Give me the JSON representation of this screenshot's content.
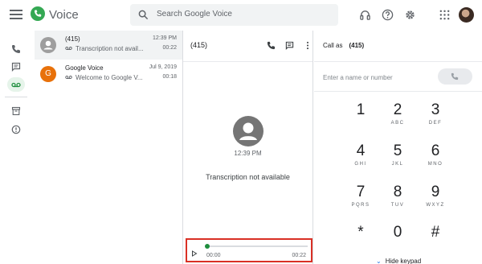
{
  "app": {
    "title": "Voice",
    "brand_color": "#34a853",
    "search_placeholder": "Search Google Voice",
    "header_icons": [
      "headset-icon",
      "help-icon",
      "settings-icon",
      "apps-icon"
    ]
  },
  "rail": {
    "items": [
      "phone-icon",
      "messages-icon",
      "voicemail-icon",
      "archive-icon",
      "spam-icon"
    ],
    "active": "voicemail-icon"
  },
  "conversations": [
    {
      "name": "(415)",
      "date": "12:39 PM",
      "snippet": "Transcription not avail...",
      "duration": "00:22",
      "avatar_color": "#9e9e9e",
      "avatar_letter": "",
      "selected": true
    },
    {
      "name": "Google Voice",
      "date": "Jul 9, 2019",
      "snippet": "Welcome to Google V...",
      "duration": "00:18",
      "avatar_color": "#e8710a",
      "avatar_letter": "G",
      "selected": false
    }
  ],
  "thread": {
    "title": "(415)",
    "time": "12:39 PM",
    "message": "Transcription not available",
    "player": {
      "current": "00:00",
      "total": "00:22",
      "progress": 0.0
    }
  },
  "dialer": {
    "call_as_label": "Call as",
    "call_as_number": "(415)",
    "input_placeholder": "Enter a name or number",
    "keys": [
      {
        "digit": "1",
        "letters": ""
      },
      {
        "digit": "2",
        "letters": "ABC"
      },
      {
        "digit": "3",
        "letters": "DEF"
      },
      {
        "digit": "4",
        "letters": "GHI"
      },
      {
        "digit": "5",
        "letters": "JKL"
      },
      {
        "digit": "6",
        "letters": "MNO"
      },
      {
        "digit": "7",
        "letters": "PQRS"
      },
      {
        "digit": "8",
        "letters": "TUV"
      },
      {
        "digit": "9",
        "letters": "WXYZ"
      },
      {
        "digit": "*",
        "letters": ""
      },
      {
        "digit": "0",
        "letters": ""
      },
      {
        "digit": "#",
        "letters": ""
      }
    ],
    "hide_keypad": "Hide keypad"
  }
}
